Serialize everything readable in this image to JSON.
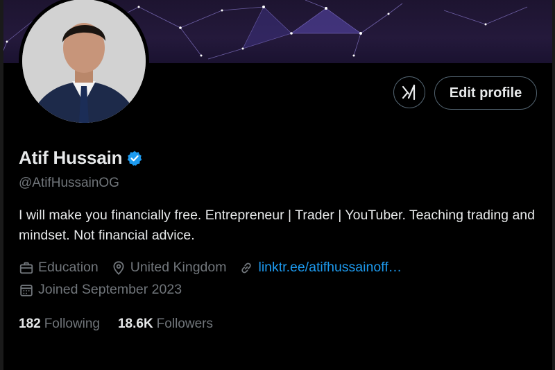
{
  "colors": {
    "background": "#000000",
    "primary_text": "#e7e9ea",
    "secondary_text": "#71767b",
    "link": "#1d9bf0",
    "verified_badge": "#1d9bf0",
    "banner_bg": "#24193b"
  },
  "actions": {
    "grok_icon": "grok-icon",
    "edit_label": "Edit profile"
  },
  "profile": {
    "name": "Atif Hussain",
    "handle": "@AtifHussainOG",
    "bio": "I will make you financially free. Entrepreneur | Trader | YouTuber. Teaching trading and mindset. Not financial advice.",
    "category_icon": "briefcase-icon",
    "category": "Education",
    "location_icon": "location-pin-icon",
    "location": "United Kingdom",
    "link_icon": "link-icon",
    "website": "linktr.ee/atifhussainoff…",
    "joined_icon": "calendar-icon",
    "joined": "Joined September 2023"
  },
  "stats": {
    "following_count": "182",
    "following_label": "Following",
    "followers_count": "18.6K",
    "followers_label": "Followers"
  }
}
